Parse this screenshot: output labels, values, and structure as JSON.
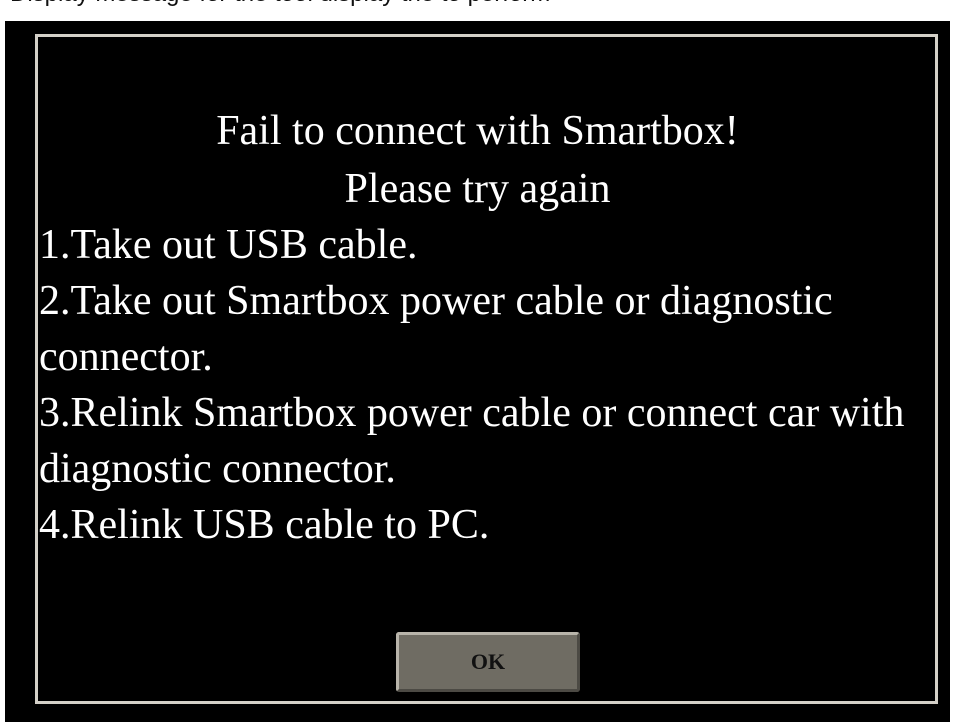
{
  "background_caption": "Display message for the tool display the to perform",
  "dialog": {
    "title_line_1": "Fail to connect with Smartbox!",
    "title_line_2": "Please try again",
    "instructions": [
      "1.Take out USB cable.",
      "2.Take out Smartbox power cable or diagnostic connector.",
      "3.Relink Smartbox power cable or connect car with diagnostic connector.",
      "4.Relink USB cable to PC."
    ],
    "ok_button_label": "OK"
  },
  "colors": {
    "dialog_background": "#000000",
    "dialog_text": "#ffffff",
    "frame_border": "#d4d0c8",
    "button_face": "#6f6c63"
  }
}
